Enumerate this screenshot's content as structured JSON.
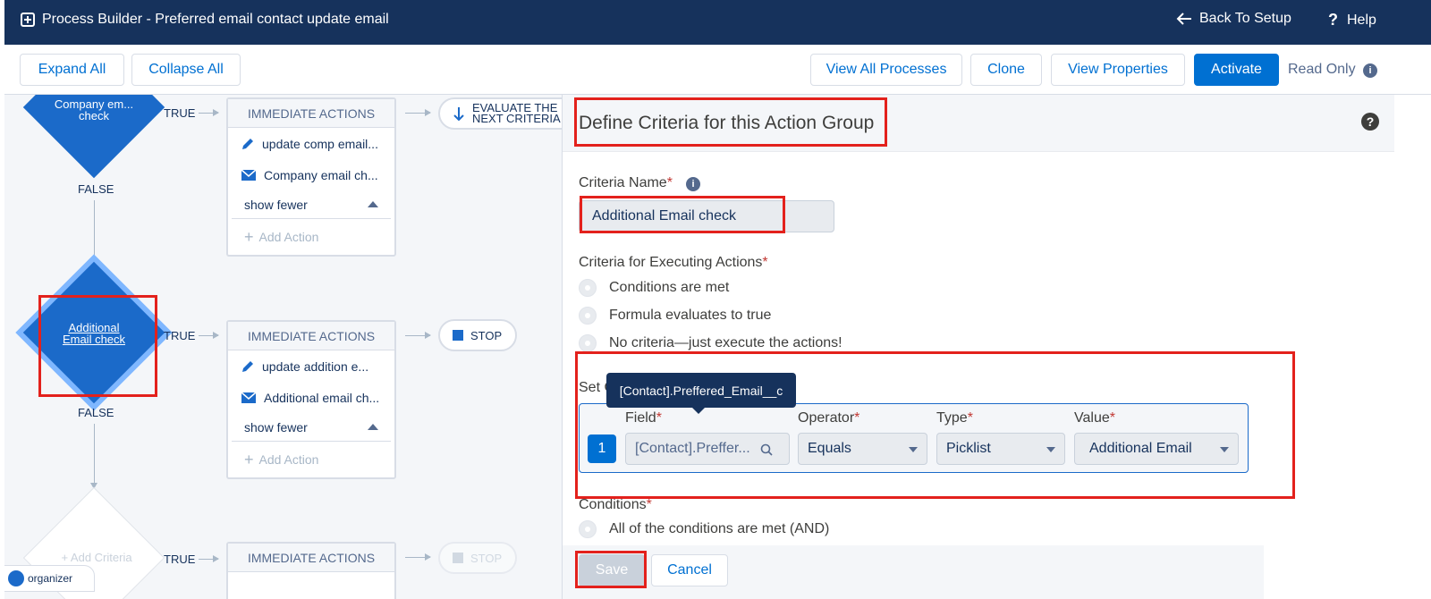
{
  "header": {
    "title": "Process Builder - Preferred email contact update email",
    "back_label": "Back To Setup",
    "help_label": "Help"
  },
  "toolbar": {
    "expand_all": "Expand All",
    "collapse_all": "Collapse All",
    "view_all_processes": "View All Processes",
    "clone": "Clone",
    "view_properties": "View Properties",
    "activate": "Activate",
    "read_only": "Read Only"
  },
  "canvas": {
    "node1": {
      "label": "Company em... check",
      "true": "TRUE",
      "false": "FALSE"
    },
    "node2": {
      "label": "Additional Email check",
      "true": "TRUE",
      "false": "FALSE"
    },
    "node3": {
      "label": "+ Add Criteria",
      "true": "TRUE"
    },
    "card1": {
      "head": "IMMEDIATE ACTIONS",
      "actions": [
        "update comp email...",
        "Company email ch..."
      ],
      "show_fewer": "show fewer",
      "add_action": "Add Action"
    },
    "card2": {
      "head": "IMMEDIATE ACTIONS",
      "actions": [
        "update addition e...",
        "Additional email ch..."
      ],
      "show_fewer": "show fewer",
      "add_action": "Add Action"
    },
    "card3": {
      "head": "IMMEDIATE ACTIONS"
    },
    "evaluate_label": "EVALUATE THE NEXT CRITERIA",
    "stop_label": "STOP",
    "stop_label_2": "STOP",
    "organizer": "organizer"
  },
  "panel": {
    "title": "Define Criteria for this Action Group",
    "criteria_name_label": "Criteria Name",
    "criteria_name_value": "Additional Email check",
    "executing_label": "Criteria for Executing Actions",
    "options": [
      "Conditions are met",
      "Formula evaluates to true",
      "No criteria—just execute the actions!"
    ],
    "set_conditions_label": "Set C",
    "tooltip": "[Contact].Preffered_Email__c",
    "columns": {
      "field": "Field",
      "operator": "Operator",
      "type": "Type",
      "value": "Value"
    },
    "row": {
      "index": "1",
      "field": "[Contact].Preffer...",
      "operator": "Equals",
      "type": "Picklist",
      "value": "Additional Email"
    },
    "conditions_label": "Conditions",
    "conditions_option": "All of the conditions are met (AND)",
    "save": "Save",
    "cancel": "Cancel",
    "required_mark": "*"
  },
  "colors": {
    "header_bg": "#16325c",
    "brand": "#0070d2",
    "annotation_red": "#e3211c"
  }
}
